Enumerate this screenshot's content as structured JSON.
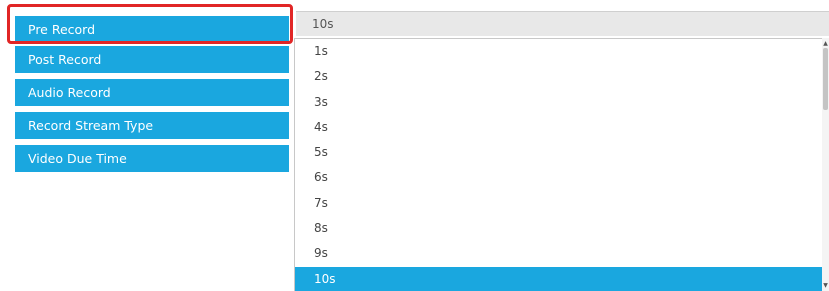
{
  "colors": {
    "accent": "#1aa7df",
    "highlight_border": "#e12626",
    "select_background": "#e8e8e8"
  },
  "sidebar": {
    "items": [
      {
        "label": "Pre Record"
      },
      {
        "label": "Post Record"
      },
      {
        "label": "Audio Record"
      },
      {
        "label": "Record Stream Type"
      },
      {
        "label": "Video Due Time"
      }
    ]
  },
  "pre_record_select": {
    "value": "10s",
    "options": [
      "1s",
      "2s",
      "3s",
      "4s",
      "5s",
      "6s",
      "7s",
      "8s",
      "9s",
      "10s"
    ],
    "selected_option": "10s"
  },
  "icons": {
    "scroll_up": "chevron-up-icon",
    "scroll_down": "chevron-down-icon"
  }
}
